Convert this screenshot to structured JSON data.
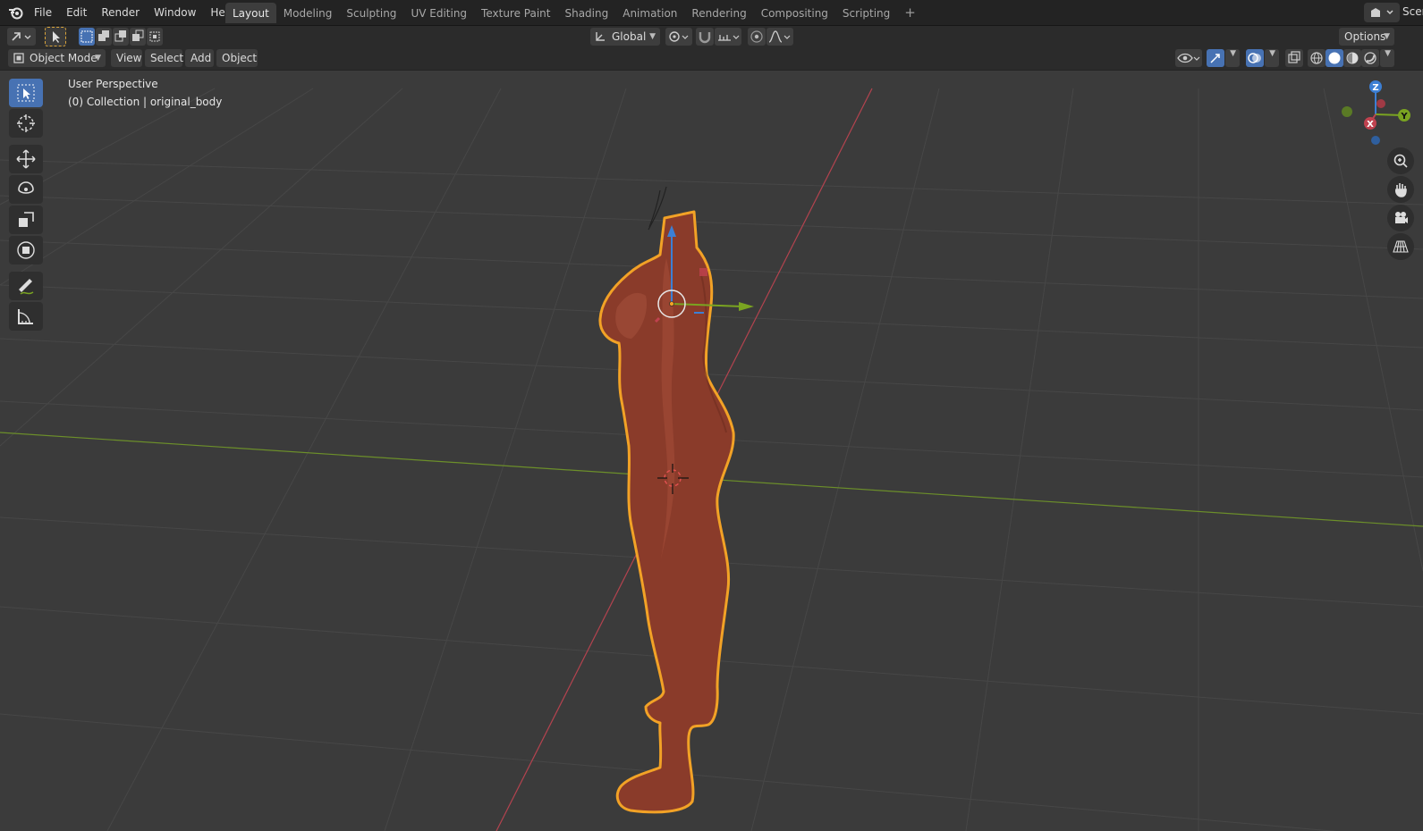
{
  "app": {
    "name": "Blender"
  },
  "menu": [
    "File",
    "Edit",
    "Render",
    "Window",
    "Help"
  ],
  "workspaces": [
    "Layout",
    "Modeling",
    "Sculpting",
    "UV Editing",
    "Texture Paint",
    "Shading",
    "Animation",
    "Rendering",
    "Compositing",
    "Scripting"
  ],
  "active_workspace": "Layout",
  "add_workspace": "+",
  "scene_label": "Scene",
  "toolbar": {
    "transform_orientation": "Global",
    "options_label": "Options"
  },
  "viewport_header": {
    "mode": "Object Mode",
    "menus": [
      "View",
      "Select",
      "Add",
      "Object"
    ]
  },
  "viewport": {
    "view_name": "User Perspective",
    "collection_info": "(0) Collection | original_body"
  },
  "gizmo_axes": {
    "x": "X",
    "y": "Y",
    "z": "Z"
  },
  "tools": [
    "select-box-tool",
    "cursor-tool",
    "move-tool",
    "rotate-tool",
    "scale-tool",
    "transform-tool",
    "annotate-tool",
    "measure-tool"
  ],
  "colors": {
    "accent": "#4772b3",
    "viewport_bg": "#3b3b3b",
    "x_axis": "#c0424f",
    "y_axis": "#7aa421",
    "z_axis": "#3c7fd4",
    "selection_outline": "#f2a226",
    "model": "#8a3b2a"
  }
}
